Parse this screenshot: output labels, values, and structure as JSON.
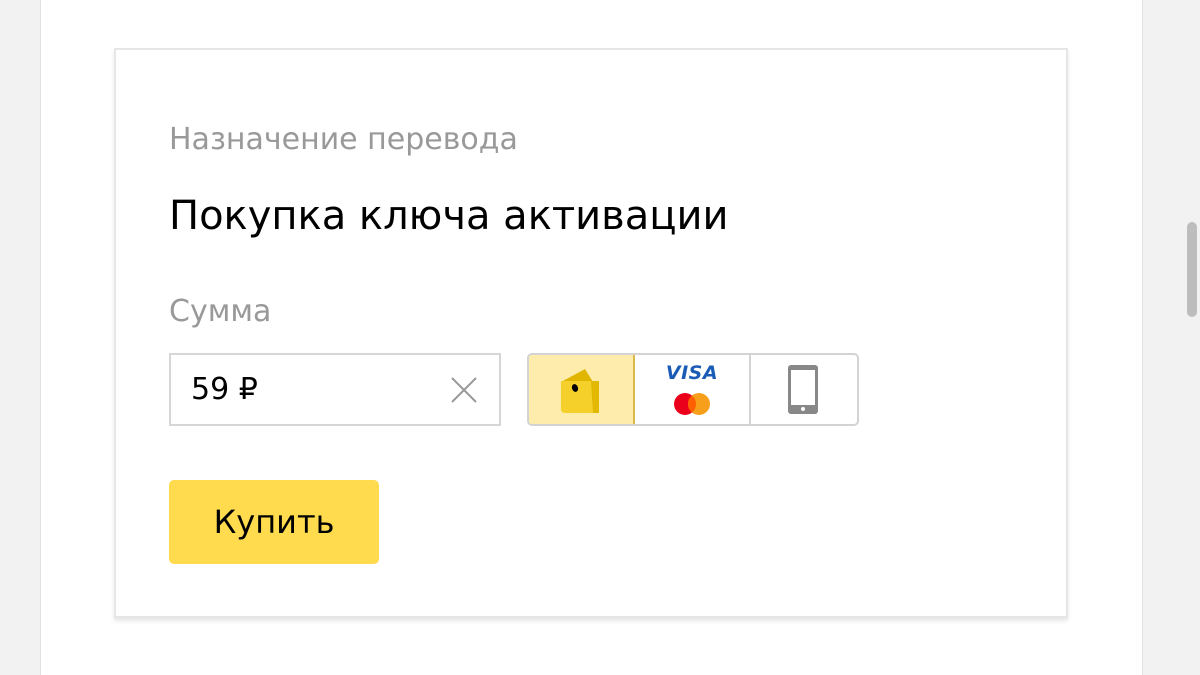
{
  "form": {
    "purpose_label": "Назначение перевода",
    "purpose_value": "Покупка ключа активации",
    "amount_label": "Сумма",
    "amount_value": "59 ₽",
    "buy_label": "Купить"
  },
  "payment_methods": [
    {
      "id": "wallet",
      "icon": "wallet-icon",
      "selected": true
    },
    {
      "id": "card",
      "icon": "visa-mastercard-icon",
      "label": "VISA",
      "selected": false
    },
    {
      "id": "phone",
      "icon": "mobile-phone-icon",
      "selected": false
    }
  ],
  "colors": {
    "accent": "#ffdb4d",
    "wallet_selected_bg": "#fdecab",
    "wallet_icon": "#f5cf2a",
    "visa_blue": "#1a5bb5",
    "mastercard_red": "#eb001b",
    "mastercard_orange": "#f79e1b",
    "label_gray": "#999999"
  }
}
